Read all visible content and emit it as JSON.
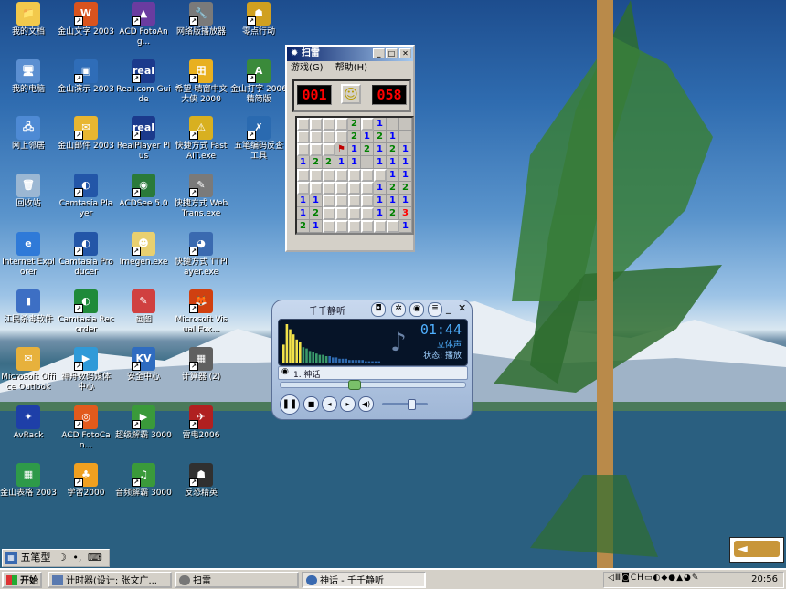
{
  "desktop": {
    "icons": [
      {
        "label": "我的文档",
        "color": "#f2c94c",
        "glyph": "📁",
        "shortcut": false
      },
      {
        "label": "我的电脑",
        "color": "#5b8fd1",
        "glyph": "🖥",
        "shortcut": false
      },
      {
        "label": "网上邻居",
        "color": "#4e8ad4",
        "glyph": "🖧",
        "shortcut": false
      },
      {
        "label": "回收站",
        "color": "#9bb7d3",
        "glyph": "🗑",
        "shortcut": false
      },
      {
        "label": "Internet Explorer",
        "color": "#2f7ad8",
        "glyph": "e",
        "shortcut": false
      },
      {
        "label": "江民杀毒软件",
        "color": "#3d6fc4",
        "glyph": "▮",
        "shortcut": false
      },
      {
        "label": "Microsoft Office Outlook",
        "color": "#e7b13c",
        "glyph": "✉",
        "shortcut": false
      },
      {
        "label": "AvRack",
        "color": "#1e3fa8",
        "glyph": "✦",
        "shortcut": false
      },
      {
        "label": "金山表格 2003",
        "color": "#2e9a49",
        "glyph": "▦",
        "shortcut": false
      },
      {
        "label": "金山文字 2003",
        "color": "#d9531e",
        "glyph": "W",
        "shortcut": true
      },
      {
        "label": "金山演示 2003",
        "color": "#2f6db8",
        "glyph": "▣",
        "shortcut": true
      },
      {
        "label": "金山邮件 2003",
        "color": "#e8b631",
        "glyph": "✉",
        "shortcut": true
      },
      {
        "label": "Camtasia Player",
        "color": "#2356a8",
        "glyph": "◐",
        "shortcut": true
      },
      {
        "label": "Camtasia Producer",
        "color": "#2356a8",
        "glyph": "◐",
        "shortcut": true
      },
      {
        "label": "Camtasia Recorder",
        "color": "#1f8a3a",
        "glyph": "◐",
        "shortcut": true
      },
      {
        "label": "神舟数码媒体中心",
        "color": "#2f9ad8",
        "glyph": "▶",
        "shortcut": true
      },
      {
        "label": "ACD FotoCan...",
        "color": "#e25a1c",
        "glyph": "◎",
        "shortcut": true
      },
      {
        "label": "学習2000",
        "color": "#f0a020",
        "glyph": "♣",
        "shortcut": true
      },
      {
        "label": "ACD FotoAng...",
        "color": "#6a3ca0",
        "glyph": "▲",
        "shortcut": true
      },
      {
        "label": "Real.com Guide",
        "color": "#1b3a8c",
        "glyph": "real",
        "shortcut": true
      },
      {
        "label": "RealPlayer Plus",
        "color": "#1b3a8c",
        "glyph": "real",
        "shortcut": true
      },
      {
        "label": "ACDSee 5.0",
        "color": "#2a7a3a",
        "glyph": "◉",
        "shortcut": true
      },
      {
        "label": "Imegen.exe",
        "color": "#e8d070",
        "glyph": "☻",
        "shortcut": true
      },
      {
        "label": "画图",
        "color": "#d04040",
        "glyph": "✎",
        "shortcut": false
      },
      {
        "label": "安全中心",
        "color": "#2f6cc0",
        "glyph": "KV",
        "shortcut": true
      },
      {
        "label": "超级解霸 3000",
        "color": "#3a9a3a",
        "glyph": "▶",
        "shortcut": true
      },
      {
        "label": "音频解霸 3000",
        "color": "#3a9a3a",
        "glyph": "♫",
        "shortcut": true
      },
      {
        "label": "网络版播放器",
        "color": "#7a7a7a",
        "glyph": "🔧",
        "shortcut": true
      },
      {
        "label": "希望-晴窗中文大侠 2000",
        "color": "#e8b020",
        "glyph": "田",
        "shortcut": true
      },
      {
        "label": "快捷方式 FastAIT.exe",
        "color": "#d8b020",
        "glyph": "⚠",
        "shortcut": true
      },
      {
        "label": "快捷方式 WebTrans.exe",
        "color": "#7a7a7a",
        "glyph": "✎",
        "shortcut": true
      },
      {
        "label": "快捷方式 TTPlayer.exe",
        "color": "#3a6ab0",
        "glyph": "◕",
        "shortcut": true
      },
      {
        "label": "Microsoft Visual Fox...",
        "color": "#d04010",
        "glyph": "🦊",
        "shortcut": true
      },
      {
        "label": "计算器 (2)",
        "color": "#606060",
        "glyph": "▦",
        "shortcut": true
      },
      {
        "label": "雷电2006",
        "color": "#b02020",
        "glyph": "✈",
        "shortcut": true
      },
      {
        "label": "反恐精英",
        "color": "#303030",
        "glyph": "☗",
        "shortcut": true
      },
      {
        "label": "零点行动",
        "color": "#d0a020",
        "glyph": "☗",
        "shortcut": true
      },
      {
        "label": "金山打字 2006精简版",
        "color": "#3a8a3a",
        "glyph": "A",
        "shortcut": true
      },
      {
        "label": "五笔编码反查工具",
        "color": "#2a6ab0",
        "glyph": "✗",
        "shortcut": true
      }
    ]
  },
  "minesweeper": {
    "title": "扫雷",
    "menu": [
      "游戏(G)",
      "帮助(H)"
    ],
    "mines_left": "001",
    "timer": "058",
    "face": "☺",
    "grid": [
      [
        " ",
        " ",
        " ",
        " ",
        "2",
        "F",
        "1",
        " ",
        " "
      ],
      [
        " ",
        " ",
        " ",
        " ",
        "2",
        "1",
        "2",
        "1",
        " "
      ],
      [
        " ",
        " ",
        " ",
        "F",
        "1",
        "2",
        "1",
        "2",
        "1"
      ],
      [
        "1",
        "2",
        "2",
        "1",
        "1",
        " ",
        "1",
        "1",
        "1"
      ],
      [
        " ",
        " ",
        " ",
        " ",
        " ",
        " ",
        "1",
        "1",
        "1"
      ],
      [
        " ",
        " ",
        " ",
        " ",
        " ",
        " ",
        "1",
        "2",
        "2",
        "1"
      ],
      [
        "1",
        "1",
        " ",
        " ",
        " ",
        " ",
        "1",
        "1",
        "1",
        "2"
      ],
      [
        "1",
        "2",
        "1",
        " ",
        " ",
        " ",
        "1",
        "2",
        "3",
        "1"
      ],
      [
        "2",
        "1",
        "1",
        " ",
        " ",
        " ",
        " ",
        "1",
        "1"
      ]
    ],
    "layout": [
      "ooooo#ooo",
      "ooooooooo",
      "ooooooooo",
      "ooooooooo",
      "oooooo#oo",
      "ooooooooo",
      "ooooooooo",
      "ooooooooo",
      "ooooooooo"
    ]
  },
  "player": {
    "title": "千千静听",
    "time": "01:44",
    "channel": "立体声",
    "status": "状态: 播放",
    "track": "1. 神话",
    "spectrum": [
      14,
      30,
      26,
      22,
      18,
      16,
      12,
      11,
      9,
      8,
      7,
      6,
      6,
      5,
      5,
      4,
      4,
      3,
      3,
      3,
      2,
      2,
      2,
      2,
      2,
      1,
      1,
      1,
      1,
      1
    ]
  },
  "ime": {
    "name": "五笔型",
    "mode_icon": "☽",
    "punct_icon": "•,",
    "keyboard_icon": "⌨"
  },
  "taskbar": {
    "start_label": "开始",
    "buttons": [
      {
        "label": "计时器(设计: 张文广..."
      },
      {
        "label": "扫雷"
      },
      {
        "label": "神话 - 千千静听"
      }
    ],
    "tray": {
      "clock": "20:56",
      "items": [
        "◁",
        "Ⅲ",
        "◙",
        "CH",
        "▭",
        "◐",
        "◆",
        "●",
        "▲",
        "◕",
        "✎"
      ]
    }
  },
  "back_arrow": {
    "label": "◄"
  }
}
